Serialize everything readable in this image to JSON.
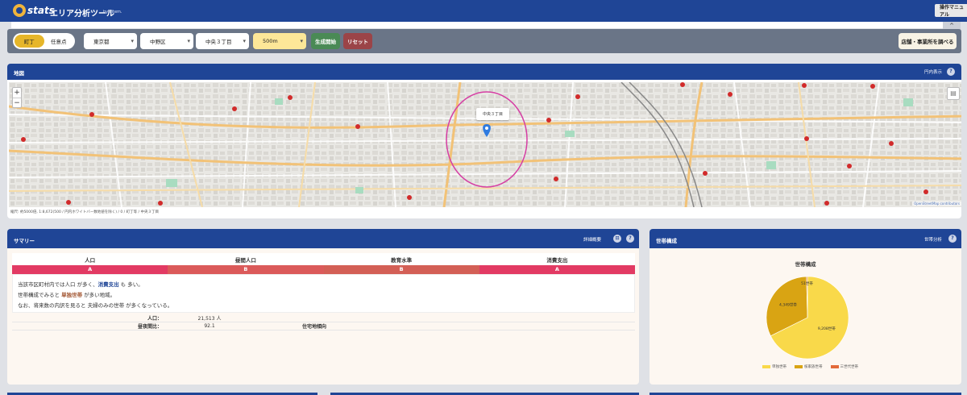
{
  "header": {
    "logo_text": "stats",
    "title": "エリア分析ツール",
    "by": "by Pitem.",
    "manual_button": "操作マニュアル",
    "collapse": "^"
  },
  "filters": {
    "mode_options": [
      "町丁",
      "任意点"
    ],
    "mode_selected": "町丁",
    "prefecture": "東京都",
    "city": "中野区",
    "town": "中央３丁目",
    "radius": "500m",
    "generate_button": "生成開始",
    "reset_button": "リセット",
    "store_button": "店舗・事業所を調べる"
  },
  "map_panel": {
    "title": "地図",
    "circle_toggle": "円内表示",
    "info": "?",
    "pin_label": "中央３丁目",
    "zoom_in": "+",
    "zoom_out": "−",
    "layers": "▤",
    "credit": "OpenStreetMap contributors",
    "caption": "縮尺: 約5000倍, 1:8,672(500 / 円内ホワイトバー数地値を除く) / 0 / 町丁等 / 中央３丁目"
  },
  "summary": {
    "title": "サマリー",
    "detail_link": "詳細概要",
    "icon_a": "⊡",
    "icon_b": "?",
    "columns": [
      "人口",
      "昼間人口",
      "教育水準",
      "消費支出"
    ],
    "grades": [
      "A",
      "B",
      "B",
      "A"
    ],
    "grade_colors": [
      "#e23a63",
      "#db5a5a",
      "#d35f56",
      "#e23a63"
    ],
    "desc_line1_pre": "当該市区町村内では人口 が多く、",
    "desc_line1_hl": "消費支出",
    "desc_line1_post": " も 多い。",
    "desc_line2_pre": "世帯構成でみると ",
    "desc_line2_hl": "単独世帯",
    "desc_line2_post": " が多い地域。",
    "desc_line3": "なお、将来数の内訳を見ると 夫婦のみの世帯 が多くなっている。",
    "row1_label": "人口：",
    "row1_value": "21,513 人",
    "row2_label": "昼夜間比：",
    "row2_value": "92.1",
    "row2_label2": "住宅地傾向"
  },
  "household_panel": {
    "title": "世帯構成",
    "link": "世帯分析",
    "icon": "?"
  },
  "chart_data": {
    "type": "pie",
    "title": "世帯構成",
    "slices": [
      {
        "label": "単独世帯",
        "value": 9208,
        "value_text": "9,208世帯",
        "color": "#f9d94a"
      },
      {
        "label": "核家族世帯",
        "value": 4349,
        "value_text": "4,349世帯",
        "color": "#d9a413"
      },
      {
        "label": "三世代世帯",
        "value": 51,
        "value_text": "51世帯",
        "color": "#e36a3a"
      }
    ],
    "legend_position": "bottom"
  }
}
